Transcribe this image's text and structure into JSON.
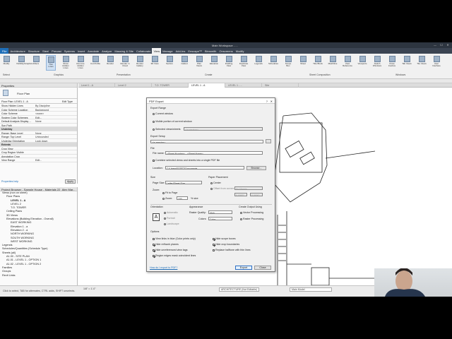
{
  "window": {
    "title": "Main Workspace - ...",
    "min": "—",
    "max": "☐",
    "close": "✕"
  },
  "menu_tabs": [
    {
      "label": "File"
    },
    {
      "label": "Architecture"
    },
    {
      "label": "Structure"
    },
    {
      "label": "Steel"
    },
    {
      "label": "Precast"
    },
    {
      "label": "Systems"
    },
    {
      "label": "Insert"
    },
    {
      "label": "Annotate"
    },
    {
      "label": "Analyze"
    },
    {
      "label": "Massing & Site"
    },
    {
      "label": "Collaborate"
    },
    {
      "label": "View"
    },
    {
      "label": "Manage"
    },
    {
      "label": "Add-Ins"
    },
    {
      "label": "Enscape™"
    },
    {
      "label": "Bimsmith"
    },
    {
      "label": "Onscreens"
    },
    {
      "label": "Modify"
    }
  ],
  "ribbon": {
    "buttons": [
      "Modify",
      "Visibility/Graphics",
      "Filters",
      "Thin Lines",
      "Show Hidden Lines",
      "Remove Hidden Lines",
      "Cut Profile",
      "Render",
      "Render in Cloud",
      "Render Gallery",
      "3D View",
      "Section",
      "Callout",
      "Plan Views",
      "Elevation",
      "Drafting View",
      "Duplicate View",
      "Legends",
      "Schedules",
      "Scope Box",
      "Sheet",
      "Title Block",
      "Matchline",
      "View Reference",
      "Viewports",
      "Switch Windows",
      "Close Inactive",
      "Tab Views",
      "Tile Views",
      "User Interface"
    ],
    "panels": {
      "select": "Select",
      "graphics": "Graphics",
      "presentation": "Presentation",
      "create": "Create",
      "sheet_composition": "Sheet Composition",
      "windows": "Windows"
    }
  },
  "properties": {
    "header": "Properties",
    "type_name": "Floor Plan",
    "instance": "Floor Plan: LEVEL 1 - A",
    "edit_type": "Edit Type",
    "rows": [
      {
        "k": "Show Hidden Lines",
        "v": "By Discipline"
      },
      {
        "k": "Color Scheme Location",
        "v": "Background"
      },
      {
        "k": "Color Scheme",
        "v": "<none>"
      },
      {
        "k": "System Color Schemes",
        "v": "Edit..."
      },
      {
        "k": "Default Analysis Display ...",
        "v": "None"
      },
      {
        "k": "Sun Path",
        "v": ""
      },
      {
        "k": "Underlay",
        "v": "",
        "sec": true
      },
      {
        "k": "Range: Base Level",
        "v": "None"
      },
      {
        "k": "Range: Top Level",
        "v": "Unbounded"
      },
      {
        "k": "Underlay Orientation",
        "v": "Look down"
      },
      {
        "k": "Extents",
        "v": "",
        "sec": true
      },
      {
        "k": "Crop View",
        "v": ""
      },
      {
        "k": "Crop Region Visible",
        "v": ""
      },
      {
        "k": "Annotation Crop",
        "v": ""
      },
      {
        "k": "View Range",
        "v": "Edit..."
      }
    ],
    "help_link": "Properties help",
    "apply": "Apply"
  },
  "browser": {
    "header": "Project Browser - Sample House - Materials 22_Alex Mar...",
    "items": [
      {
        "t": "Views (non on sheet)",
        "d": 0
      },
      {
        "t": "Floor Plans",
        "d": 1
      },
      {
        "t": "LEVEL 1 - A",
        "d": 2,
        "bold": true
      },
      {
        "t": "LEVEL 2",
        "d": 2
      },
      {
        "t": "T.O. TOWER",
        "d": 2
      },
      {
        "t": "Ceiling Plans",
        "d": 1
      },
      {
        "t": "3D Views",
        "d": 1
      },
      {
        "t": "Elevations (Building Elevation - Overall)",
        "d": 1
      },
      {
        "t": "EAST WORKING",
        "d": 2
      },
      {
        "t": "Elevation 1 - a",
        "d": 2
      },
      {
        "t": "Elevation 2 - a",
        "d": 2
      },
      {
        "t": "NORTH WORKING",
        "d": 2
      },
      {
        "t": "SOUTH WORKING",
        "d": 2
      },
      {
        "t": "WEST WORKING",
        "d": 2
      },
      {
        "t": "Legends",
        "d": 0
      },
      {
        "t": "Schedules/Quantities (Schedule Type)",
        "d": 0
      },
      {
        "t": "Sheets (all)",
        "d": 0
      },
      {
        "t": "A1.00 - SITE PLAN",
        "d": 1
      },
      {
        "t": "A1.01 - LEVEL 1 - OPTION 1",
        "d": 1
      },
      {
        "t": "A1.02 - LEVEL 1 - OPTION 2",
        "d": 1
      },
      {
        "t": "Families",
        "d": 0
      },
      {
        "t": "Groups",
        "d": 0
      },
      {
        "t": "Revit Links",
        "d": 0
      }
    ]
  },
  "view_tabs": [
    {
      "label": "Level 1 - A"
    },
    {
      "label": "Level 2"
    },
    {
      "label": "T.O. TOWER"
    },
    {
      "label": "LEVEL 1 - A"
    },
    {
      "label": "LEVEL 1 - ..."
    },
    {
      "label": "Site"
    }
  ],
  "status": {
    "left": "Click to select, TAB for alternates, CTRL adds, SHIFT unselects.",
    "scale": "1/8\" = 1'-0\"",
    "workset": "ARCHITECTURE (Not Editable)",
    "model": "Main Model"
  },
  "pdf": {
    "title": "PDF Export",
    "help": "?",
    "close": "✕",
    "export_range": "Export Range",
    "current_window": "Current window",
    "visible_portion": "Visible portion of current window",
    "selected": "Selected views/sheets",
    "selected_field": "<in session>",
    "file_label": "File",
    "file_name_label": "File name:",
    "file_name": "<Sheet Number> - <Sheet Name>",
    "combine": "Combine selected views and sheets into a single PDF file",
    "location_label": "Location:",
    "location": "C:\\Users\\ESSET\\Documents",
    "browse": "Browse...",
    "export_setup_label": "Export Setup",
    "setup_value": "<in-session>",
    "size_label": "Size",
    "page_size_label": "Page Size:",
    "page_size": "Letter/Sheet Size",
    "zoom_label": "Zoom:",
    "fit_to_page": "Fit to Page",
    "zoom": "Zoom:",
    "zoom_value": "100",
    "zoom_unit": "% size",
    "placement_label": "Paper Placement",
    "center": "Center",
    "offset": "Offset from corner:",
    "no_margin": "No Margin",
    "x_val": "0.0000\"",
    "y_val": "0.0000\"",
    "orientation_label": "Orientation",
    "automatic": "Automatic",
    "portrait": "Portrait",
    "landscape": "Landscape",
    "appearance_label": "Appearance",
    "raster_label": "Raster Quality:",
    "raster_value": "High",
    "colors_label": "Colors:",
    "colors_value": "Color",
    "output_label": "Create Output Using",
    "vector": "Vector Processing",
    "raster": "Raster Processing",
    "options_label": "Options",
    "opt_links_blue": "View links in blue (Color prints only)",
    "opt_ref_planes": "Hide ref/work planes",
    "opt_unref": "Hide unreferenced view tags",
    "opt_regions": "Region edges mask coincident lines",
    "opt_scope": "Hide scope boxes",
    "opt_crop": "Hide crop boundaries",
    "opt_halftone": "Replace halftone with thin lines",
    "how_to": "How do I export to PDF?",
    "export_btn": "Export",
    "close_btn": "Close"
  }
}
